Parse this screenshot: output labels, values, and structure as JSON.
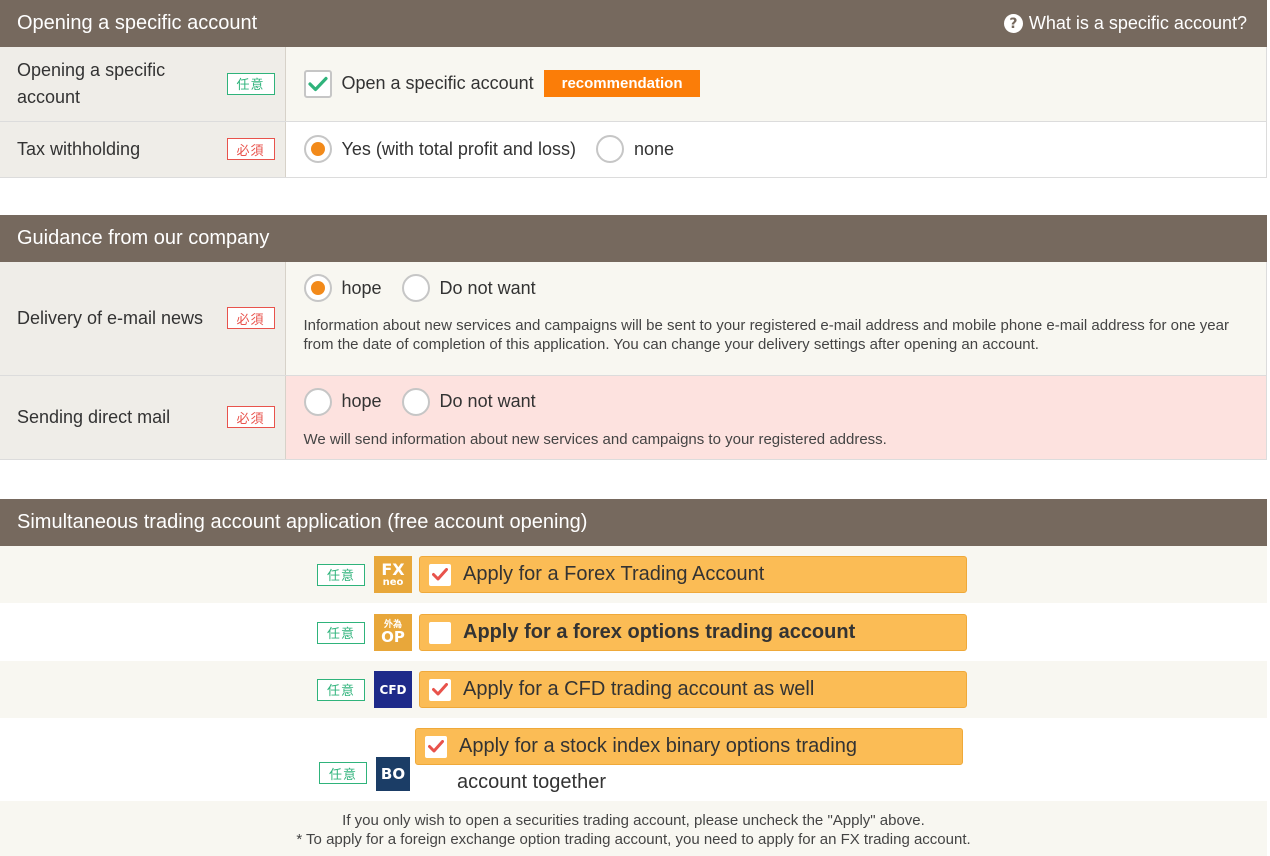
{
  "section1": {
    "title": "Opening a specific account",
    "help_link": "What is a specific account?",
    "help_icon": "?",
    "rows": [
      {
        "label": "Opening a specific account",
        "badge": "任意",
        "checkbox_label": "Open a specific account",
        "recommend": "recommendation",
        "checked": true
      },
      {
        "label": "Tax withholding",
        "badge": "必須",
        "options": [
          "Yes (with total profit and loss)",
          "none"
        ],
        "selected": 0
      }
    ]
  },
  "section2": {
    "title": "Guidance from our company",
    "rows": [
      {
        "label": "Delivery of e-mail news",
        "badge": "必須",
        "options": [
          "hope",
          "Do not want"
        ],
        "selected": 0,
        "note": "Information about new services and campaigns will be sent to your registered e-mail address and mobile phone e-mail address for one year from the date of completion of this application. You can change your delivery settings after opening an account."
      },
      {
        "label": "Sending direct mail",
        "badge": "必須",
        "options": [
          "hope",
          "Do not want"
        ],
        "selected": null,
        "note": "We will send information about new services and campaigns to your registered address."
      }
    ]
  },
  "section3": {
    "title": "Simultaneous trading account application (free account opening)",
    "items": [
      {
        "badge": "任意",
        "logo_line1": "FX",
        "logo_line2": "neo",
        "label": "Apply for a Forex Trading Account",
        "checked": true
      },
      {
        "badge": "任意",
        "logo_line1": "外為",
        "logo_line2": "OP",
        "label": "Apply for a forex options trading account",
        "checked": false
      },
      {
        "badge": "任意",
        "logo_line1": "CFD",
        "label": "Apply for a CFD trading account as well",
        "checked": true
      },
      {
        "badge": "任意",
        "logo_line1": "BO",
        "label": "Apply for a stock index binary options trading",
        "label_cont": "account together",
        "checked": true
      }
    ],
    "footnote_1": "If you only wish to open a securities trading account, please uncheck the \"Apply\" above.",
    "footnote_2": "* To apply for a foreign exchange option trading account, you need to apply for an FX trading account."
  },
  "colors": {
    "header_bg": "#76695e",
    "accent_orange": "#fb7d08",
    "apply_bg": "#fbbc55",
    "check_red": "#e8534c",
    "check_green": "#2fb37b"
  }
}
